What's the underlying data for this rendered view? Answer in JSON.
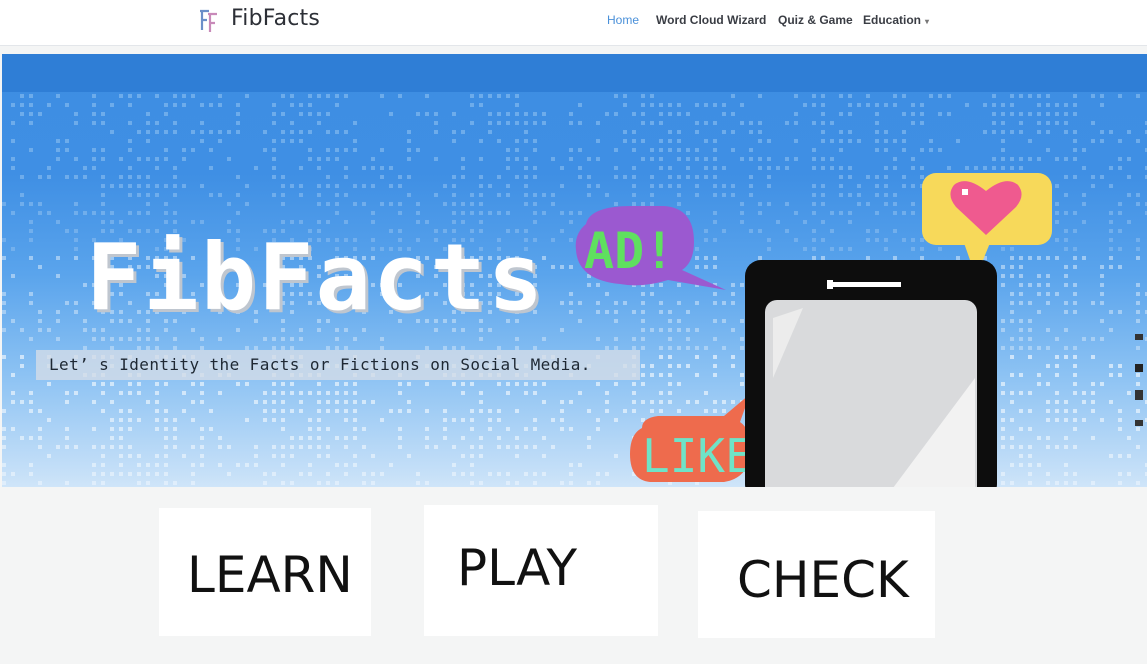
{
  "site": {
    "name": "FibFacts",
    "logo_icon": "fibfacts-logo-icon"
  },
  "nav": {
    "items": [
      {
        "label": "Home",
        "active": true
      },
      {
        "label": "Word Cloud Wizard",
        "active": false
      },
      {
        "label": "Quiz & Game",
        "active": false
      },
      {
        "label": "Education",
        "active": false,
        "has_dropdown": true
      }
    ],
    "active_color": "#4a90d9"
  },
  "hero": {
    "title": "FibFacts",
    "tagline": "Let’ s Identity the Facts or Fictions on Social Media.",
    "bubble_ad": "AD!",
    "bubble_like": "LIKE",
    "heart_icon": "heart-icon",
    "phone_icon": "phone-icon"
  },
  "cards": {
    "learn": "LEARN",
    "play": "PLAY",
    "check": "CHECK"
  },
  "colors": {
    "hero_blue": "#3f8fe4",
    "ad_bubble": "#9b59d0",
    "ad_text": "#5fe05f",
    "like_bubble": "#ee6b4d",
    "like_text": "#6fe3c7",
    "heart_bubble": "#f7d95a",
    "heart": "#ef5a8f"
  }
}
